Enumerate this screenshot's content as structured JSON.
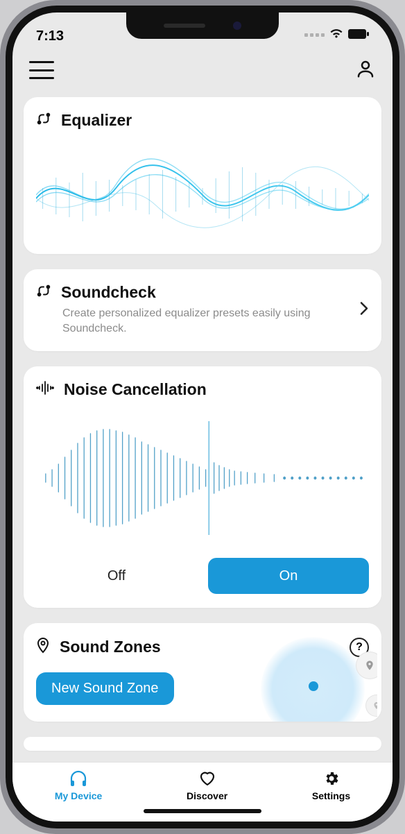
{
  "status": {
    "time": "7:13"
  },
  "cards": {
    "equalizer": {
      "title": "Equalizer"
    },
    "soundcheck": {
      "title": "Soundcheck",
      "subtitle": "Create personalized equalizer presets easily using Soundcheck."
    },
    "noise_cancellation": {
      "title": "Noise Cancellation",
      "off_label": "Off",
      "on_label": "On"
    },
    "sound_zones": {
      "title": "Sound Zones",
      "help": "?",
      "new_btn": "New Sound Zone"
    }
  },
  "nav": {
    "my_device": "My Device",
    "discover": "Discover",
    "settings": "Settings"
  },
  "colors": {
    "accent": "#1a98d8"
  }
}
